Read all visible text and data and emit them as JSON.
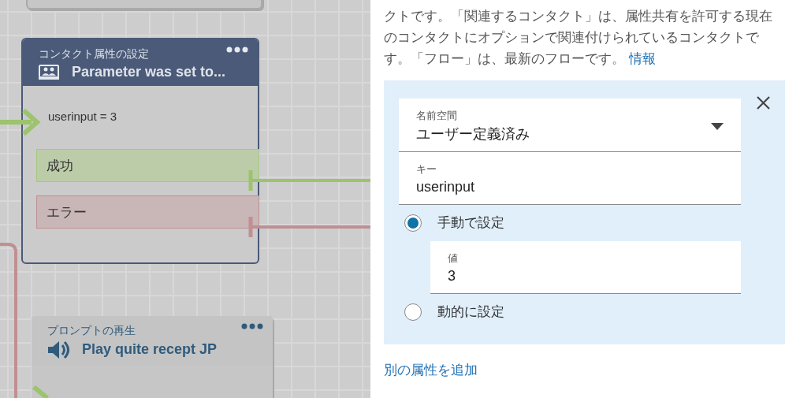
{
  "canvas": {
    "nodes": [
      {
        "type_label": "コンタクト属性の設定",
        "title": "Parameter was set to...",
        "kind": "attribute",
        "selected": true,
        "body": "userinput = 3",
        "branches": [
          {
            "label": "成功",
            "kind": "success"
          },
          {
            "label": "エラー",
            "kind": "error"
          }
        ]
      },
      {
        "type_label": "プロンプトの再生",
        "title": "Play quite recept JP",
        "kind": "prompt",
        "selected": false
      }
    ]
  },
  "panel": {
    "description": "クトです。「関連するコンタクト」は、属性共有を許可する現在のコンタクトにオプションで関連付けられているコンタクトです。「フロー」は、最新のフローです。",
    "info_link": "情報",
    "attribute": {
      "namespace": {
        "label": "名前空間",
        "value": "ユーザー定義済み"
      },
      "key": {
        "label": "キー",
        "value": "userinput"
      },
      "options": [
        {
          "label": "手動で設定",
          "selected": true,
          "field": {
            "label": "値",
            "value": "3"
          }
        },
        {
          "label": "動的に設定",
          "selected": false
        }
      ]
    },
    "add_link": "別の属性を追加"
  }
}
